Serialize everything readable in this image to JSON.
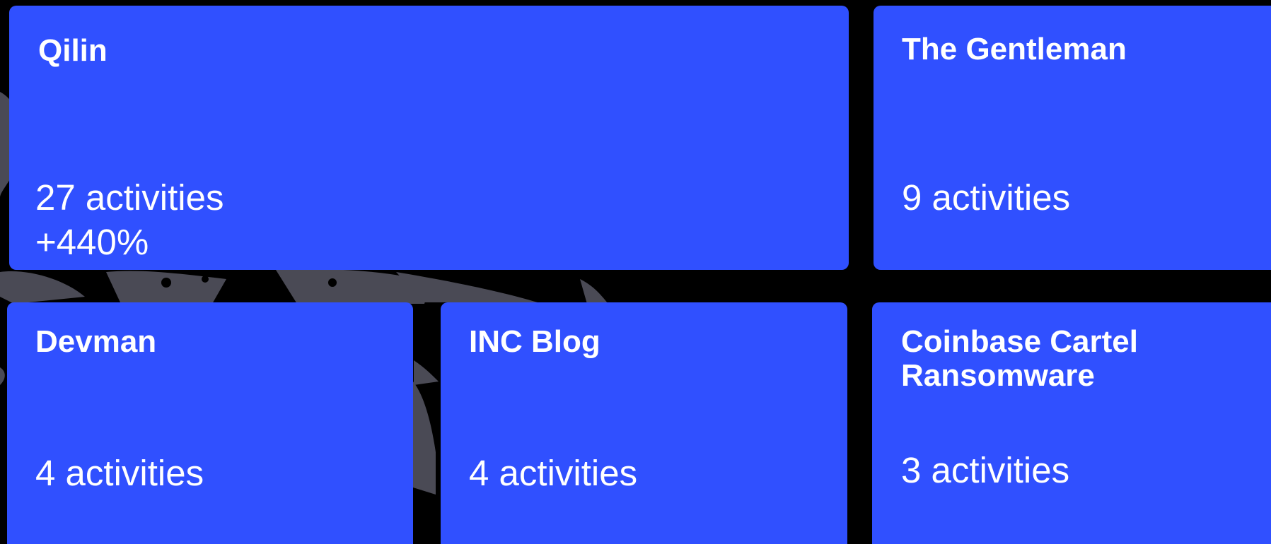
{
  "tiles": [
    {
      "name": "Qilin",
      "count": "27 activities",
      "change": "+440%"
    },
    {
      "name": "The Gentleman",
      "count": "9 activities"
    },
    {
      "name": "Devman",
      "count": "4 activities"
    },
    {
      "name": "INC Blog",
      "count": "4 activities"
    },
    {
      "name": "Coinbase Cartel\nRansomware",
      "count": "3 activities"
    }
  ],
  "colors": {
    "tile_background": "#3050ff",
    "page_background": "#000000",
    "map_silhouette": "#4a4a55",
    "text": "#ffffff"
  }
}
